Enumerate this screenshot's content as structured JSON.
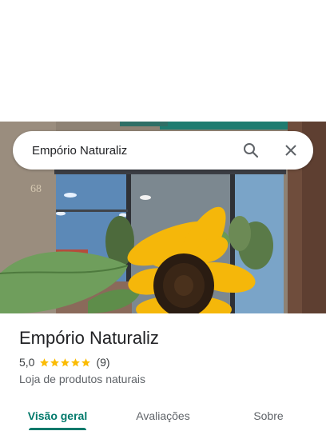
{
  "search": {
    "query": "Empório Naturaliz",
    "search_icon": "search-icon",
    "close_icon": "close-icon"
  },
  "photo": {
    "sign_number": "68"
  },
  "place": {
    "name": "Empório Naturaliz",
    "rating": "5,0",
    "stars": 5,
    "review_count": "(9)",
    "category": "Loja de produtos naturais",
    "star_color": "#fbbc04"
  },
  "tabs": [
    {
      "label": "Visão geral",
      "active": true
    },
    {
      "label": "Avaliações",
      "active": false
    },
    {
      "label": "Sobre",
      "active": false
    }
  ],
  "colors": {
    "accent": "#00796b"
  }
}
